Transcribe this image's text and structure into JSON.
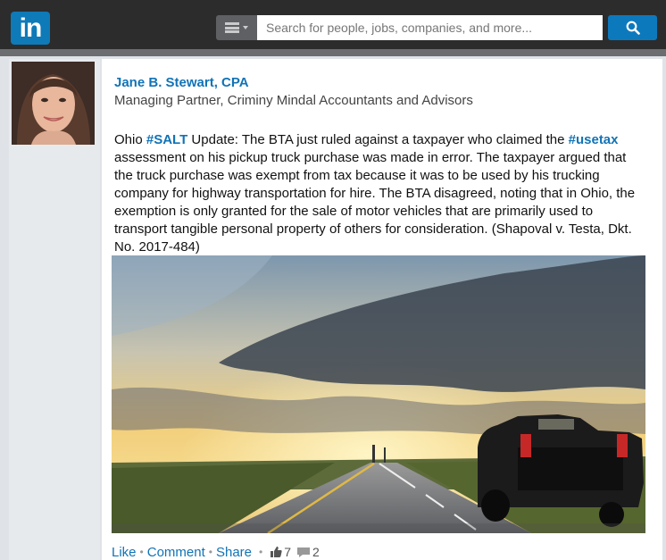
{
  "header": {
    "logo_text": "in",
    "search_placeholder": "Search for people, jobs, companies, and more...",
    "colors": {
      "bar": "#2c2c2c",
      "brand": "#0e7ab8"
    }
  },
  "post": {
    "author_name": "Jane B. Stewart, CPA",
    "author_headline": "Managing Partner, Criminy Mindal Accountants and Advisors",
    "body": {
      "p1": "Ohio ",
      "tag1": "#SALT",
      "p2": " Update: The BTA just ruled against a taxpayer who claimed the ",
      "tag2": "#usetax",
      "p3": " assessment on his pickup truck purchase was made in error. The taxpayer argued that the truck purchase was exempt from tax because it was to be used by his trucking company for highway transportation for hire. The BTA disagreed, noting that in Ohio, the exemption is only granted for the sale of motor vehicles that are primarily used to transport tangible personal property of others for consideration. (Shapoval v. Testa, Dkt. No. 2017-484)"
    },
    "actions": {
      "like": "Like",
      "comment": "Comment",
      "share": "Share",
      "likes_count": "7",
      "comments_count": "2"
    }
  }
}
